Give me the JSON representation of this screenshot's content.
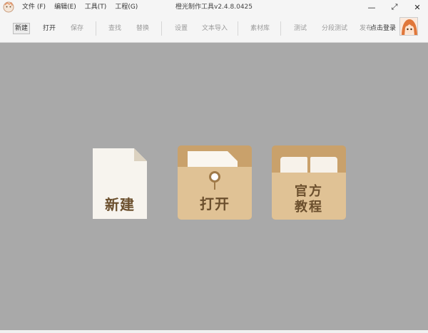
{
  "titlebar": {
    "title": "橙光制作工具v2.4.8.0425",
    "menus": [
      {
        "label": "文件 (F)"
      },
      {
        "label": "编辑(E)"
      },
      {
        "label": "工具(T)"
      },
      {
        "label": "工程(G)"
      }
    ],
    "controls": {
      "minimize": "—",
      "maximize": "⤢",
      "close": "✕"
    }
  },
  "toolbar": {
    "new": "新建",
    "open": "打开",
    "save": "保存",
    "find": "查找",
    "replace": "替换",
    "settings": "设置",
    "text_import": "文本导入",
    "asset_library": "素材库",
    "test": "测试",
    "segment_test": "分段测试",
    "publish": "发布",
    "login": "点击登录"
  },
  "tiles": {
    "new": "新建",
    "open": "打开",
    "tutorial_line1": "官方",
    "tutorial_line2": "教程"
  },
  "colors": {
    "accent": "#c9a16b",
    "accent_light": "#e0c295",
    "label_brown": "#6b4f2d",
    "background": "#a9a9a9"
  }
}
